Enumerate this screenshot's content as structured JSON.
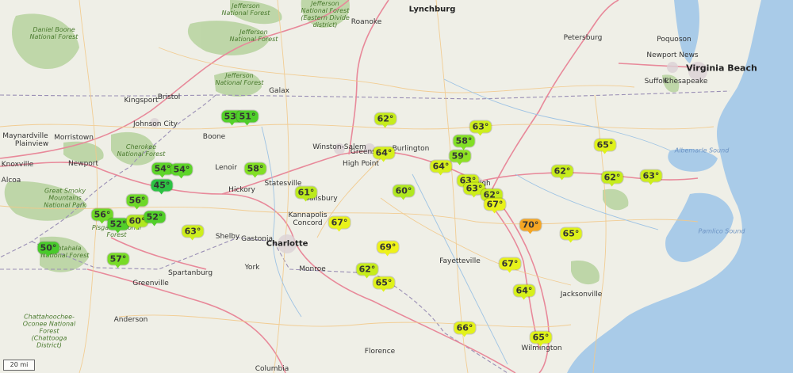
{
  "map": {
    "scale_label": "20 mi",
    "labels": [
      {
        "text": "Daniel Boone National Forest",
        "cls": "forest"
      },
      {
        "text": "Jefferson National Forest",
        "cls": "forest"
      },
      {
        "text": "Jefferson National Forest",
        "cls": "forest"
      },
      {
        "text": "Jefferson National Forest (Eastern Divide district)",
        "cls": "forest"
      },
      {
        "text": "Jefferson National Forest",
        "cls": "forest"
      },
      {
        "text": "Lynchburg",
        "cls": "city"
      },
      {
        "text": "Roanoke",
        "cls": ""
      },
      {
        "text": "Petersburg",
        "cls": ""
      },
      {
        "text": "Newport News",
        "cls": ""
      },
      {
        "text": "Poquoson",
        "cls": ""
      },
      {
        "text": "Virginia Beach",
        "cls": "bigcity"
      },
      {
        "text": "Suffolk",
        "cls": ""
      },
      {
        "text": "Chesapeake",
        "cls": ""
      },
      {
        "text": "Galax",
        "cls": ""
      },
      {
        "text": "Bristol",
        "cls": ""
      },
      {
        "text": "Kingsport",
        "cls": ""
      },
      {
        "text": "Johnson City",
        "cls": ""
      },
      {
        "text": "Maynardville",
        "cls": ""
      },
      {
        "text": "Morristown",
        "cls": ""
      },
      {
        "text": "Plainview",
        "cls": ""
      },
      {
        "text": "Knoxville",
        "cls": ""
      },
      {
        "text": "Newport",
        "cls": ""
      },
      {
        "text": "Alcoa",
        "cls": ""
      },
      {
        "text": "Cherokee National Forest",
        "cls": "forest"
      },
      {
        "text": "Great Smoky Mountains National Park",
        "cls": "forest"
      },
      {
        "text": "Boone",
        "cls": ""
      },
      {
        "text": "Lenoir",
        "cls": ""
      },
      {
        "text": "Hickory",
        "cls": ""
      },
      {
        "text": "Statesville",
        "cls": ""
      },
      {
        "text": "Winston-Salem",
        "cls": ""
      },
      {
        "text": "Greensboro",
        "cls": ""
      },
      {
        "text": "Burlington",
        "cls": ""
      },
      {
        "text": "High Point",
        "cls": ""
      },
      {
        "text": "Salisbury",
        "cls": ""
      },
      {
        "text": "Kannapolis",
        "cls": ""
      },
      {
        "text": "Concord",
        "cls": ""
      },
      {
        "text": "Gastonia",
        "cls": ""
      },
      {
        "text": "Shelby",
        "cls": ""
      },
      {
        "text": "Charlotte",
        "cls": "city"
      },
      {
        "text": "Monroe",
        "cls": ""
      },
      {
        "text": "York",
        "cls": ""
      },
      {
        "text": "Spartanburg",
        "cls": ""
      },
      {
        "text": "Greenville",
        "cls": ""
      },
      {
        "text": "Anderson",
        "cls": ""
      },
      {
        "text": "Nantahala National Forest",
        "cls": "forest"
      },
      {
        "text": "Chattahoochee-Oconee National Forest (Chattooga District)",
        "cls": "forest"
      },
      {
        "text": "Pisgah National Forest",
        "cls": "forest"
      },
      {
        "text": "Raleigh",
        "cls": ""
      },
      {
        "text": "Fayetteville",
        "cls": ""
      },
      {
        "text": "Jacksonville",
        "cls": ""
      },
      {
        "text": "Wilmington",
        "cls": ""
      },
      {
        "text": "Florence",
        "cls": ""
      },
      {
        "text": "Columbia",
        "cls": ""
      },
      {
        "text": "Albemarle Sound",
        "cls": "water"
      },
      {
        "text": "Pamlico Sound",
        "cls": "water"
      }
    ],
    "markers": [
      {
        "temp": "53°",
        "color": "#55d12a"
      },
      {
        "temp": "51°",
        "color": "#4fcd2a"
      },
      {
        "temp": "62°",
        "color": "#c6ec1c"
      },
      {
        "temp": "63°",
        "color": "#cdee1c"
      },
      {
        "temp": "58°",
        "color": "#82df25"
      },
      {
        "temp": "59°",
        "color": "#8ee224"
      },
      {
        "temp": "64°",
        "color": "#d6f01b"
      },
      {
        "temp": "64°",
        "color": "#d6f01b"
      },
      {
        "temp": "65°",
        "color": "#dff21a"
      },
      {
        "temp": "54°",
        "color": "#5ed42a"
      },
      {
        "temp": "54°",
        "color": "#5ed42a"
      },
      {
        "temp": "45°",
        "color": "#2cc243"
      },
      {
        "temp": "58°",
        "color": "#82df25"
      },
      {
        "temp": "62°",
        "color": "#c6ec1c"
      },
      {
        "temp": "62°",
        "color": "#c6ec1c"
      },
      {
        "temp": "63°",
        "color": "#cdee1c"
      },
      {
        "temp": "63°",
        "color": "#cdee1c"
      },
      {
        "temp": "63°",
        "color": "#cdee1c"
      },
      {
        "temp": "62°",
        "color": "#c6ec1c"
      },
      {
        "temp": "67°",
        "color": "#e8f21a"
      },
      {
        "temp": "61°",
        "color": "#bbea1e"
      },
      {
        "temp": "60°",
        "color": "#b0e820"
      },
      {
        "temp": "56°",
        "color": "#6ed828"
      },
      {
        "temp": "56°",
        "color": "#6ed828"
      },
      {
        "temp": "52°",
        "color": "#52cf2a"
      },
      {
        "temp": "60°",
        "color": "#b0e820"
      },
      {
        "temp": "52°",
        "color": "#52cf2a"
      },
      {
        "temp": "63°",
        "color": "#cdee1c"
      },
      {
        "temp": "67°",
        "color": "#e8f21a"
      },
      {
        "temp": "70°",
        "color": "#f5a623"
      },
      {
        "temp": "65°",
        "color": "#dff21a"
      },
      {
        "temp": "50°",
        "color": "#48ca2b"
      },
      {
        "temp": "69°",
        "color": "#eef21a"
      },
      {
        "temp": "57°",
        "color": "#78db26"
      },
      {
        "temp": "62°",
        "color": "#c6ec1c"
      },
      {
        "temp": "67°",
        "color": "#e8f21a"
      },
      {
        "temp": "65°",
        "color": "#dff21a"
      },
      {
        "temp": "64°",
        "color": "#d6f01b"
      },
      {
        "temp": "66°",
        "color": "#e3f21a"
      },
      {
        "temp": "65°",
        "color": "#dff21a"
      }
    ]
  }
}
